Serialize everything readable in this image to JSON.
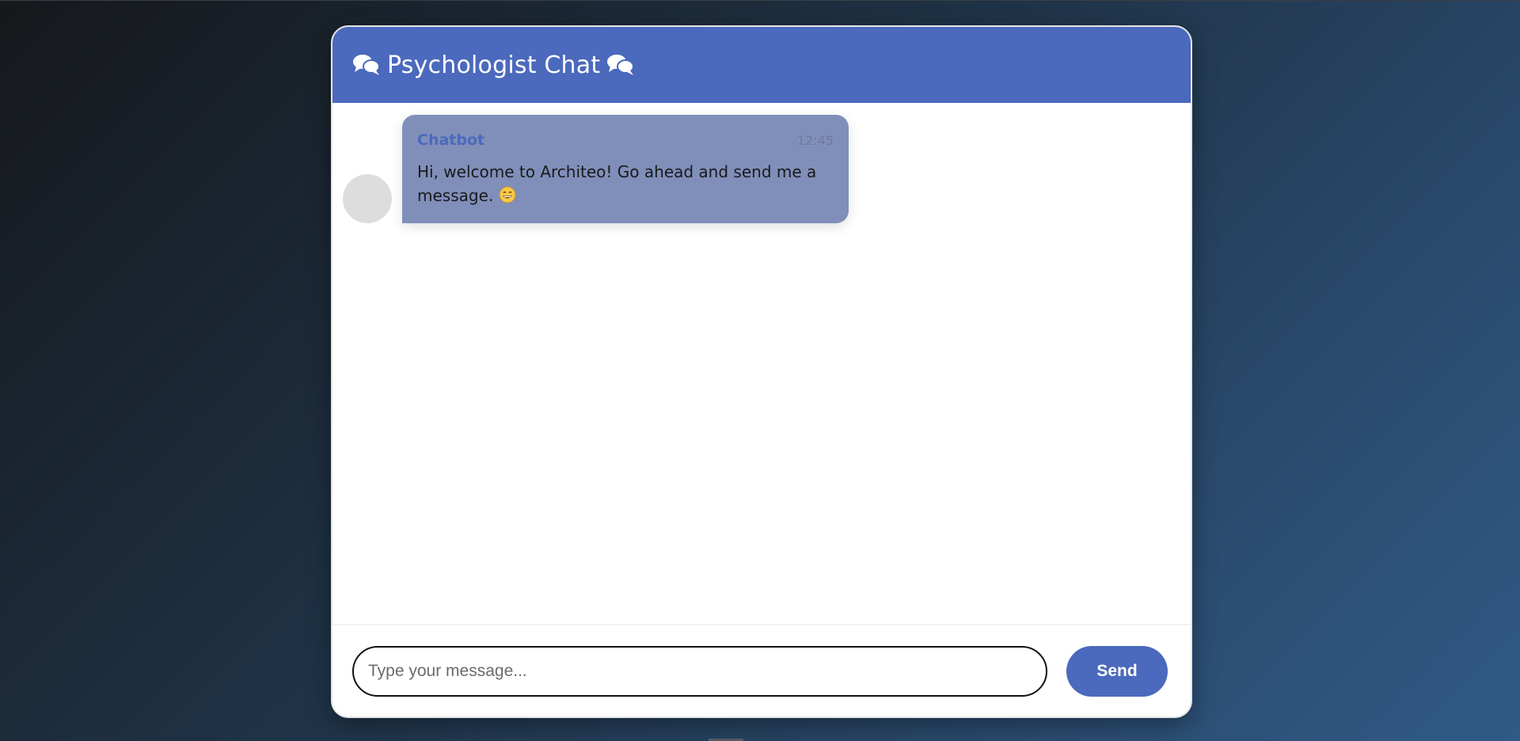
{
  "header": {
    "title": "Psychologist Chat",
    "icon_left": "comments-icon",
    "icon_right": "comments-icon"
  },
  "messages": [
    {
      "sender": "Chatbot",
      "time": "12:45",
      "text": "Hi, welcome to Architeo! Go ahead and send me a message.",
      "emoji": "grinning-face-emoji"
    }
  ],
  "composer": {
    "placeholder": "Type your message...",
    "value": "",
    "send_label": "Send"
  },
  "colors": {
    "accent": "#4b69bd",
    "bubble": "#808fba",
    "avatar": "#dddddd"
  }
}
